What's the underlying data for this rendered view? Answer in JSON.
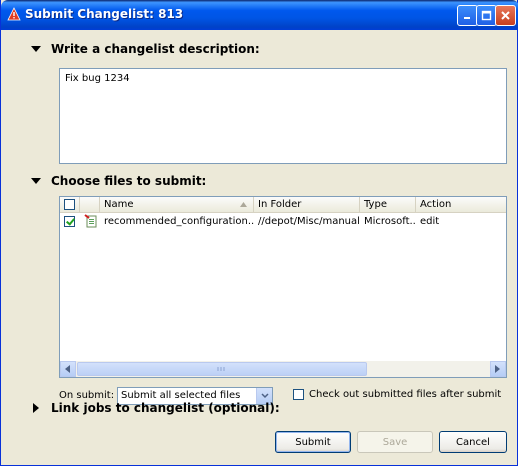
{
  "window": {
    "title": "Submit Changelist: 813"
  },
  "sections": {
    "description": {
      "label": "Write a changelist description:",
      "value": "Fix bug 1234"
    },
    "files": {
      "label": "Choose files to submit:",
      "columns": {
        "name": "Name",
        "in_folder": "In Folder",
        "type": "Type",
        "action": "Action"
      },
      "rows": [
        {
          "checked": true,
          "name": "recommended_configuration....",
          "in_folder": "//depot/Misc/manuals",
          "type": "Microsoft...",
          "action": "edit"
        }
      ]
    },
    "jobs": {
      "label": "Link jobs to changelist (optional):"
    }
  },
  "on_submit": {
    "label": "On submit:",
    "selected": "Submit all selected files",
    "checkout_label": "Check out submitted files after submit",
    "checkout_checked": false
  },
  "buttons": {
    "submit": "Submit",
    "save": "Save",
    "cancel": "Cancel"
  },
  "icons": {
    "title": "warning-triangle-icon",
    "collapse": "triangle-down-icon",
    "expand": "triangle-right-icon",
    "file": "document-edit-icon",
    "sort": "sort-up-icon"
  },
  "colors": {
    "title_bar": "#0058ee",
    "close_button": "#c6401f",
    "panel_border": "#7f9db9"
  }
}
